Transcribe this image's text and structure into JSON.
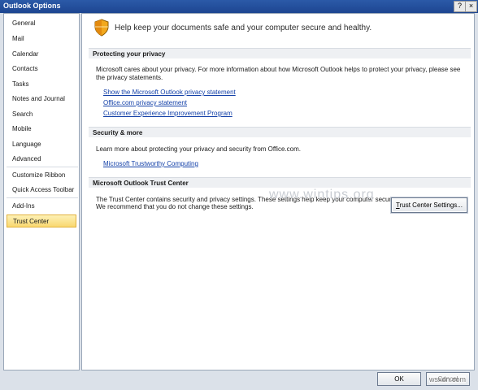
{
  "window": {
    "title": "Outlook Options",
    "help_label": "?",
    "close_label": "×"
  },
  "sidebar": {
    "items": [
      {
        "label": "General"
      },
      {
        "label": "Mail"
      },
      {
        "label": "Calendar"
      },
      {
        "label": "Contacts"
      },
      {
        "label": "Tasks"
      },
      {
        "label": "Notes and Journal"
      },
      {
        "label": "Search"
      },
      {
        "label": "Mobile"
      },
      {
        "label": "Language"
      },
      {
        "label": "Advanced"
      },
      {
        "label": "Customize Ribbon"
      },
      {
        "label": "Quick Access Toolbar"
      },
      {
        "label": "Add-Ins"
      },
      {
        "label": "Trust Center"
      }
    ],
    "selected": "Trust Center"
  },
  "main": {
    "headline": "Help keep your documents safe and your computer secure and healthy.",
    "privacy": {
      "header": "Protecting your privacy",
      "body": "Microsoft cares about your privacy. For more information about how Microsoft Outlook helps to protect your privacy, please see the privacy statements.",
      "links": [
        "Show the Microsoft Outlook privacy statement",
        "Office.com privacy statement",
        "Customer Experience Improvement Program"
      ]
    },
    "security": {
      "header": "Security & more",
      "body": "Learn more about protecting your privacy and security from Office.com.",
      "link": "Microsoft Trustworthy Computing"
    },
    "trust_center": {
      "header": "Microsoft Outlook Trust Center",
      "body_line1": "The Trust Center contains security and privacy settings. These settings help keep your computer secure.",
      "body_line2": "We recommend that you do not change these settings.",
      "button_label_underlined": "T",
      "button_label_rest": "rust Center Settings..."
    }
  },
  "footer": {
    "ok_label": "OK",
    "cancel_label": "Cancel"
  },
  "watermarks": {
    "center": "www.wintips.org",
    "corner": "wsxdn.com"
  },
  "colors": {
    "titlebar": "#1d4591",
    "link": "#1340a8",
    "selected_bg": "#f9d870",
    "arrow": "#e0202a"
  }
}
